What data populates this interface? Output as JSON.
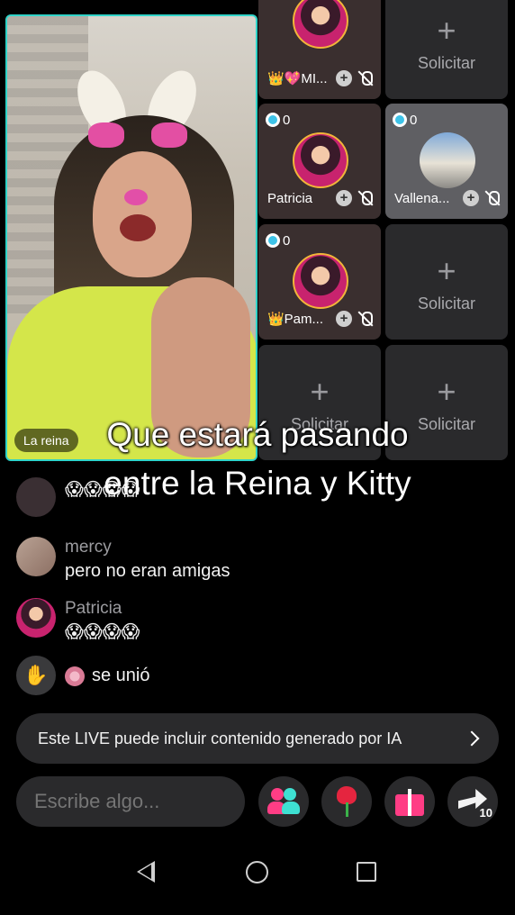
{
  "host": {
    "label": "La reina"
  },
  "guests": [
    {
      "name": "👑💖MI...",
      "count": ""
    },
    {
      "solicitar": "Solicitar"
    },
    {
      "name": "Patricia",
      "count": "0"
    },
    {
      "name": "Vallena...",
      "count": "0"
    },
    {
      "name": "👑Pam...",
      "count": "0"
    },
    {
      "solicitar": "Solicitar"
    },
    {
      "solicitar": "Solicitar"
    },
    {
      "solicitar": "Solicitar"
    }
  ],
  "caption": {
    "line1": "Que estará pasando",
    "line2": "entre la Reina y Kitty"
  },
  "chat": [
    {
      "user": "",
      "text": "😱😱😱😱"
    },
    {
      "user": "mercy",
      "text": "pero no eran amigas"
    },
    {
      "user": "Patricia",
      "text": "😱😱😱😱"
    },
    {
      "user": "",
      "text": "se unió"
    }
  ],
  "ai_notice": "Este LIVE puede incluir contenido generado por IA",
  "input": {
    "placeholder": "Escribe algo..."
  },
  "share_count": "10",
  "colors": {
    "accent_teal": "#2fd3c8",
    "pink": "#ff3d85",
    "bg": "#000000"
  }
}
